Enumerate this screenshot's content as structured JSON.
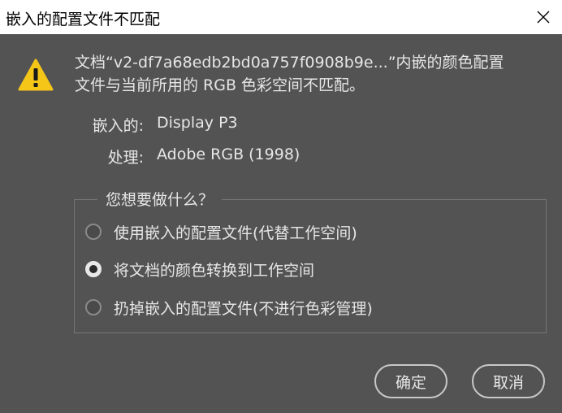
{
  "window": {
    "title": "嵌入的配置文件不匹配",
    "close_icon": "close-icon"
  },
  "message": {
    "line1": "文档“v2-df7a68edb2bd0a757f0908b9e...”内嵌的颜色配置",
    "line2": "文件与当前所用的 RGB 色彩空间不匹配。",
    "icon": "warning-icon",
    "icon_color": "#f5c518"
  },
  "embedded": {
    "label": "嵌入的:",
    "value": "Display P3"
  },
  "handling": {
    "label": "处理:",
    "value": "Adobe RGB (1998)"
  },
  "options": {
    "legend": "您想要做什么？",
    "items": [
      {
        "label": "使用嵌入的配置文件(代替工作空间)",
        "checked": false
      },
      {
        "label": "将文档的颜色转换到工作空间",
        "checked": true
      },
      {
        "label": "扔掉嵌入的配置文件(不进行色彩管理)",
        "checked": false
      }
    ]
  },
  "buttons": {
    "ok": "确定",
    "cancel": "取消"
  }
}
